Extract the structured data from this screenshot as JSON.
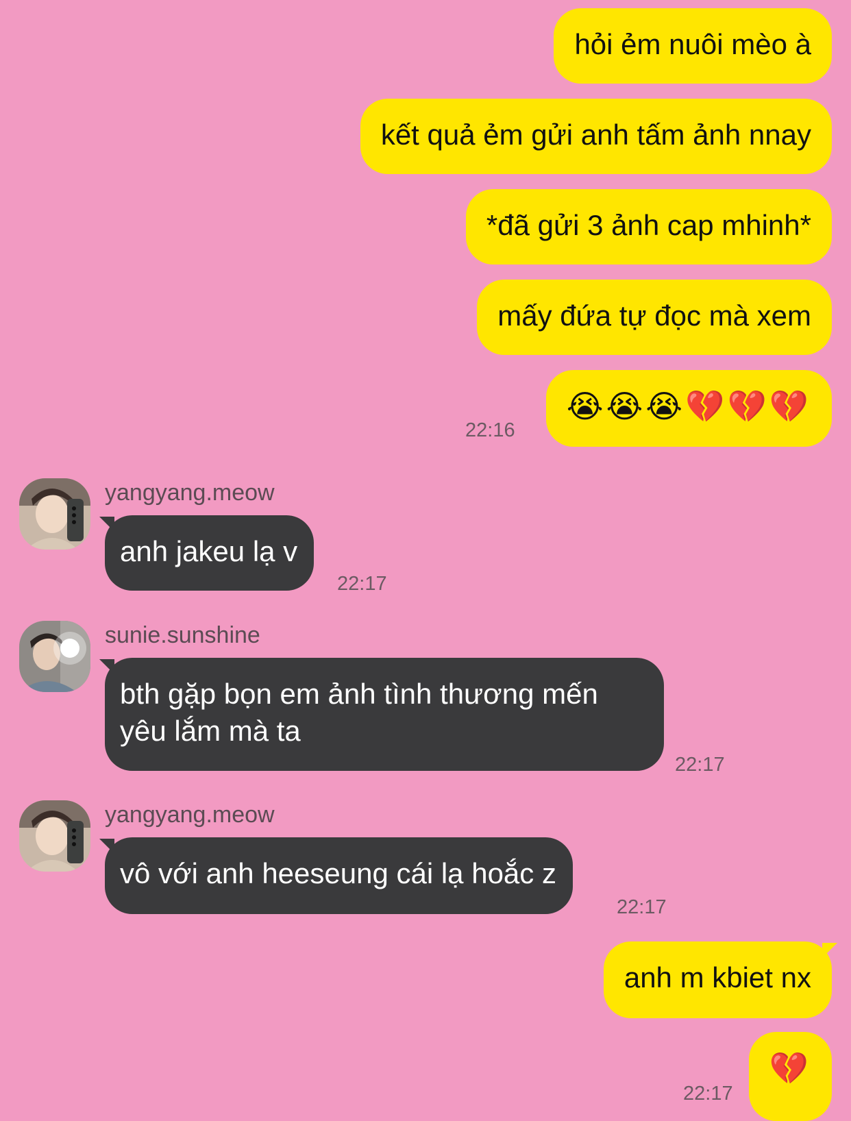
{
  "colors": {
    "background": "#f29ac2",
    "outgoing_bubble": "#ffe600",
    "incoming_bubble": "#3a3a3c",
    "timestamp": "#6b5a62"
  },
  "outgoing_top": [
    {
      "text": "hỏi ẻm nuôi mèo à"
    },
    {
      "text": "kết quả ẻm gửi anh tấm ảnh nnay"
    },
    {
      "text": "*đã gửi 3 ảnh cap mhinh*"
    },
    {
      "text": "mấy đứa tự đọc mà xem"
    },
    {
      "text": "😭😭😭💔💔💔",
      "time": "22:16"
    }
  ],
  "incoming": [
    {
      "sender": "yangyang.meow",
      "avatar_icon": "profile-photo-mirror-selfie",
      "text": "anh jakeu lạ v",
      "time": "22:17"
    },
    {
      "sender": "sunie.sunshine",
      "avatar_icon": "profile-photo-flash-selfie",
      "text": "bth gặp bọn em ảnh tình thương mến yêu lắm mà ta",
      "time": "22:17"
    },
    {
      "sender": "yangyang.meow",
      "avatar_icon": "profile-photo-mirror-selfie",
      "text": "vô với anh heeseung cái lạ hoắc z",
      "time": "22:17"
    }
  ],
  "outgoing_bottom": [
    {
      "text": "anh m kbiet nx"
    },
    {
      "text": "💔",
      "time": "22:17"
    }
  ]
}
